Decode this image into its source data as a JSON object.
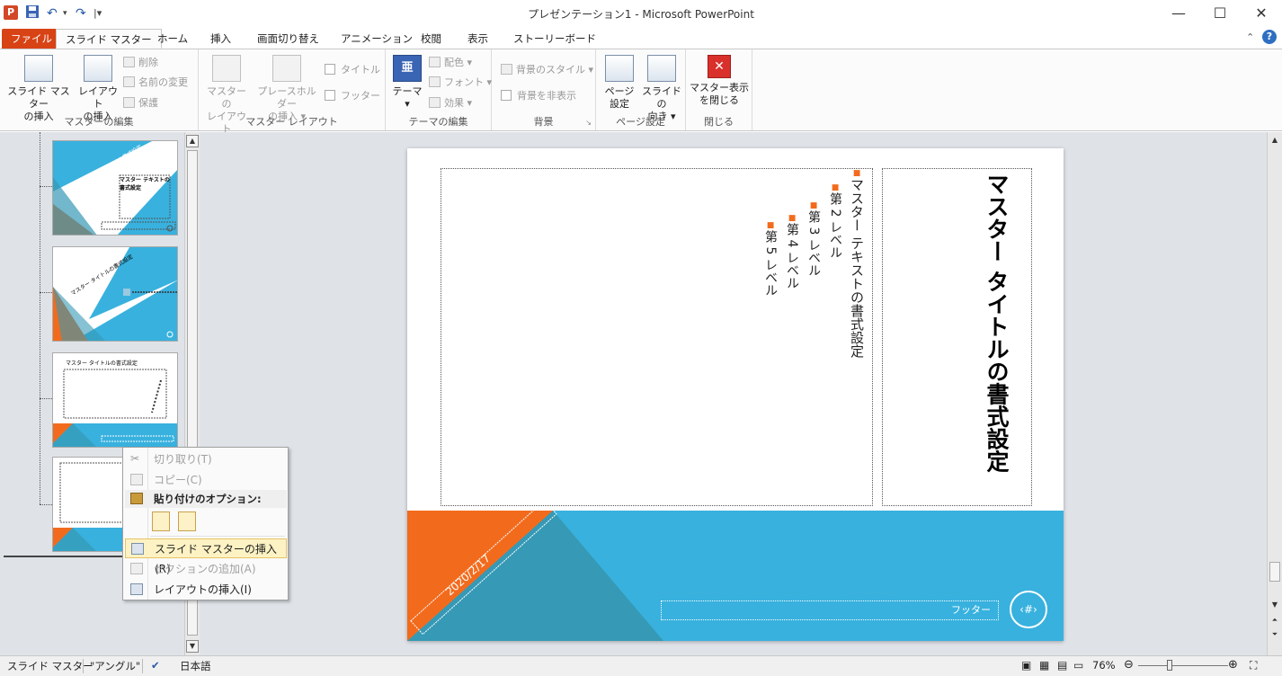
{
  "window": {
    "title": "プレゼンテーション1 - Microsoft PowerPoint",
    "app_icon_letter": "P",
    "minimize": "—",
    "maximize": "☐",
    "close": "✕"
  },
  "tabs": {
    "file": "ファイル",
    "slide_master": "スライド マスター",
    "home": "ホーム",
    "insert": "挿入",
    "transitions": "画面切り替え",
    "animations": "アニメーション",
    "review": "校閲",
    "view": "表示",
    "storyboard": "ストーリーボード"
  },
  "ribbon": {
    "edit_master": {
      "label": "マスターの編集",
      "insert_slide_master": [
        "スライド マスター",
        "の挿入"
      ],
      "insert_layout": [
        "レイアウト",
        "の挿入"
      ],
      "delete": "削除",
      "rename": "名前の変更",
      "preserve": "保護"
    },
    "master_layout": {
      "label": "マスター レイアウト",
      "master_layout_btn": [
        "マスターの",
        "レイアウト"
      ],
      "insert_placeholder": [
        "プレースホルダー",
        "の挿入 ▾"
      ],
      "title_chk": "タイトル",
      "footer_chk": "フッター"
    },
    "edit_theme": {
      "label": "テーマの編集",
      "themes": [
        "テーマ",
        "▾"
      ],
      "colors": "配色 ▾",
      "fonts": "フォント ▾",
      "effects": "効果 ▾"
    },
    "background": {
      "label": "背景",
      "styles": "背景のスタイル ▾",
      "hide": "背景を非表示"
    },
    "page_setup": {
      "label": "ページ設定",
      "page_setup_btn": [
        "ページ",
        "設定"
      ],
      "orientation": [
        "スライドの",
        "向き ▾"
      ]
    },
    "close": {
      "label": "閉じる",
      "close_master": [
        "マスター表示",
        "を閉じる"
      ]
    }
  },
  "thumbnails": {
    "t1_title": "マスター タイトルの書式設定",
    "t1_text": "マスター テキストの書式設定",
    "t2_title": "マスター タイトルの書式設定",
    "t3_title": "マスター タイトルの書式設定"
  },
  "slide": {
    "title": "マスター タイトルの書式設定",
    "body_level1": "マスター テキストの書式設定",
    "levels": [
      "第 2 レベル",
      "第 3 レベル",
      "第 4 レベル",
      "第 5 レベル"
    ],
    "date": "2020/2/17",
    "footer": "フッター",
    "page_number": "‹#›"
  },
  "context_menu": {
    "cut": "切り取り(T)",
    "copy": "コピー(C)",
    "paste_options": "貼り付けのオプション:",
    "insert_slide_master": "スライド マスターの挿入(R)",
    "add_section": "セクションの追加(A)",
    "insert_layout": "レイアウトの挿入(I)"
  },
  "statusbar": {
    "view_name": "スライド マスター",
    "theme_name": "\"アングル\"",
    "language": "日本語",
    "zoom": "76%"
  },
  "colors": {
    "orange": "#f26b1d",
    "blue": "#38b1de",
    "teal": "#3699b5"
  }
}
